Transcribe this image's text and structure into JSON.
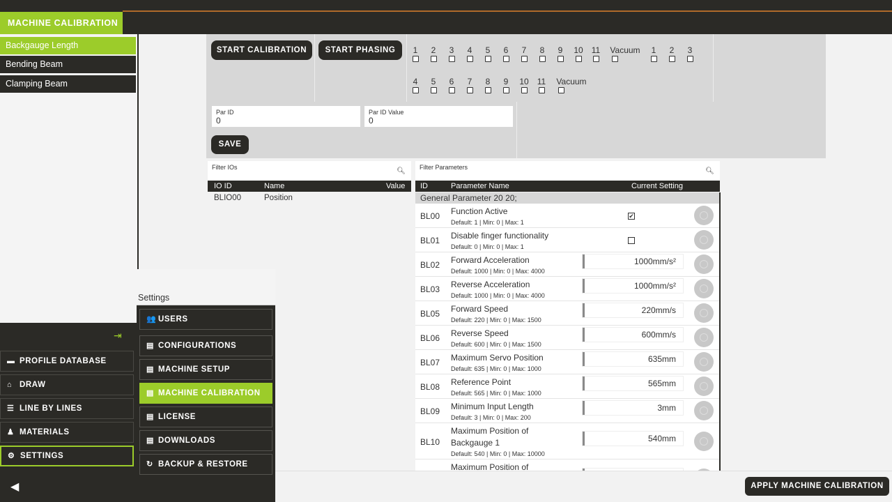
{
  "topbar": {
    "title": "MACHINE CALIBRATION"
  },
  "sidebar": {
    "items": [
      {
        "label": "Backgauge Length",
        "active": true
      },
      {
        "label": "Bending Beam",
        "active": false
      },
      {
        "label": "Clamping Beam",
        "active": false
      }
    ]
  },
  "mainmenu": {
    "items": [
      {
        "label": "PROFILE DATABASE",
        "icon": "folder-icon"
      },
      {
        "label": "DRAW",
        "icon": "home-icon"
      },
      {
        "label": "LINE BY LINES",
        "icon": "list-icon"
      },
      {
        "label": "MATERIALS",
        "icon": "materials-icon"
      },
      {
        "label": "SETTINGS",
        "icon": "gear-icon",
        "active": true
      }
    ]
  },
  "settings": {
    "title": "Settings",
    "items": [
      {
        "label": "USERS",
        "icon": "users-icon"
      },
      {
        "label": "CONFIGURATIONS",
        "icon": "config-icon"
      },
      {
        "label": "MACHINE SETUP",
        "icon": "config-icon"
      },
      {
        "label": "MACHINE CALIBRATION",
        "icon": "config-icon",
        "active": true
      },
      {
        "label": "LICENSE",
        "icon": "config-icon"
      },
      {
        "label": "DOWNLOADS",
        "icon": "config-icon"
      },
      {
        "label": "BACKUP & RESTORE",
        "icon": "refresh-icon"
      }
    ]
  },
  "calibration": {
    "start_calibration": "START CALIBRATION",
    "start_phasing": "START PHASING",
    "row1": [
      "1",
      "2",
      "3",
      "4",
      "5",
      "6",
      "7",
      "8",
      "9",
      "10",
      "11",
      "Vacuum"
    ],
    "row1b": [
      "1",
      "2",
      "3"
    ],
    "row2": [
      "4",
      "5",
      "6",
      "7",
      "8",
      "9",
      "10",
      "11",
      "Vacuum"
    ],
    "par_id": {
      "label": "Par ID",
      "value": "0"
    },
    "par_id_value": {
      "label": "Par ID Value",
      "value": "0"
    },
    "save": "SAVE"
  },
  "ios": {
    "filter_label": "Filter IOs",
    "headers": {
      "id": "IO ID",
      "name": "Name",
      "value": "Value"
    },
    "rows": [
      {
        "id": "BLIO00",
        "name": "Position",
        "value": ""
      }
    ]
  },
  "params": {
    "filter_label": "Filter Parameters",
    "headers": {
      "id": "ID",
      "name": "Parameter Name",
      "setting": "Current Setting"
    },
    "group": "General Parameter 20 20;",
    "rows": [
      {
        "id": "BL00",
        "name": "Function Active",
        "default": "Default: 1 | Min: 0 | Max: 1",
        "type": "checkbox",
        "checked": "✔"
      },
      {
        "id": "BL01",
        "name": "Disable finger functionality",
        "default": "Default: 0 | Min: 0 | Max: 1",
        "type": "checkbox",
        "checked": ""
      },
      {
        "id": "BL02",
        "name": "Forward Acceleration",
        "default": "Default: 1000 | Min: 0 | Max: 4000",
        "type": "input",
        "value": "1000mm/s²"
      },
      {
        "id": "BL03",
        "name": "Reverse Acceleration",
        "default": "Default: 1000 | Min: 0 | Max: 4000",
        "type": "input",
        "value": "1000mm/s²"
      },
      {
        "id": "BL05",
        "name": "Forward Speed",
        "default": "Default: 220 | Min: 0 | Max: 1500",
        "type": "input",
        "value": "220mm/s"
      },
      {
        "id": "BL06",
        "name": "Reverse Speed",
        "default": "Default: 600 | Min: 0 | Max: 1500",
        "type": "input",
        "value": "600mm/s"
      },
      {
        "id": "BL07",
        "name": "Maximum Servo Position",
        "default": "Default: 635 | Min: 0 | Max: 1000",
        "type": "input",
        "value": "635mm"
      },
      {
        "id": "BL08",
        "name": "Reference Point",
        "default": "Default: 565 | Min: 0 | Max: 1000",
        "type": "input",
        "value": "565mm"
      },
      {
        "id": "BL09",
        "name": "Minimum Input Length",
        "default": "Default: 3 | Min: 0 | Max: 200",
        "type": "input",
        "value": "3mm"
      },
      {
        "id": "BL10",
        "name": "Maximum Position of Backgauge 1",
        "name_line1": "Maximum Position of",
        "name_line2": "Backgauge 1",
        "default": "Default: 540 | Min: 0 | Max: 10000",
        "type": "input",
        "value": "540mm"
      },
      {
        "id": "",
        "name": "Maximum Position of",
        "default": "",
        "type": "input",
        "value": ""
      }
    ]
  },
  "footer": {
    "apply": "APPLY MACHINE CALIBRATION"
  }
}
